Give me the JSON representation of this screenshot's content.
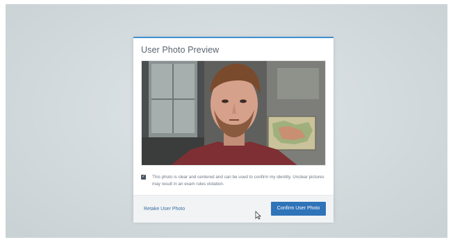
{
  "modal": {
    "title": "User Photo Preview",
    "accent_color": "#3f8fd0"
  },
  "photo": {
    "description_icon": "webcam-photo"
  },
  "consent": {
    "checked": true,
    "text": "This photo is clear and centered and can be used to confirm my identity. Unclear pictures may result in an exam rules violation."
  },
  "footer": {
    "retake_label": "Retake User Photo",
    "confirm_label": "Confirm User Photo",
    "confirm_color": "#2f73b8"
  },
  "cursor": {
    "icon": "mouse-pointer-icon"
  }
}
